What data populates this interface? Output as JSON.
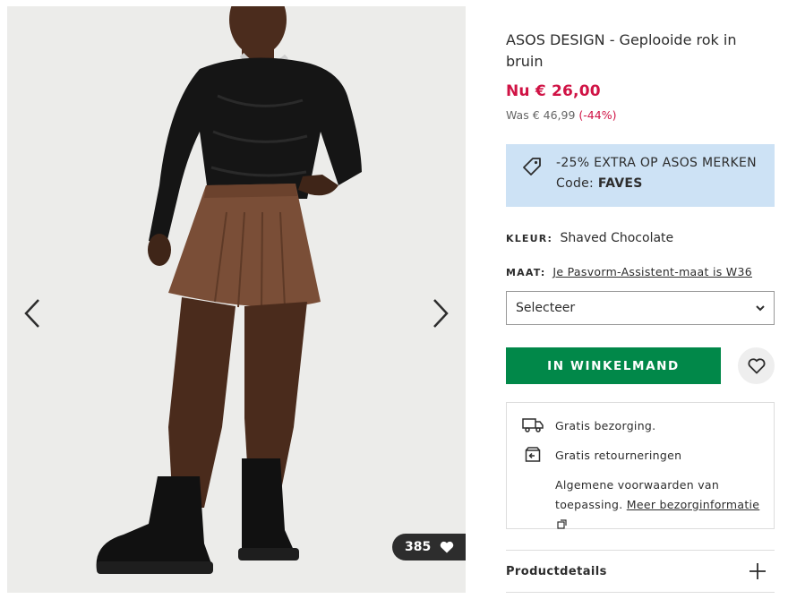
{
  "gallery": {
    "image_alt": "Model in black mesh top, brown pleated skirt and black boots",
    "prev_icon": "chevron-left-icon",
    "next_icon": "chevron-right-icon",
    "like_count": "385",
    "like_icon": "heart-icon"
  },
  "product": {
    "title": "ASOS DESIGN - Geplooide rok in bruin",
    "price_now": "Nu € 26,00",
    "price_was": "Was € 46,99",
    "discount": "(-44%)"
  },
  "promo": {
    "icon": "tag-icon",
    "line1": "-25% EXTRA OP ASOS MERKEN",
    "code_label": "Code:",
    "code": "FAVES",
    "bg_color": "#cde2f5"
  },
  "colour": {
    "label": "KLEUR:",
    "value": "Shaved Chocolate"
  },
  "size": {
    "label": "MAAT:",
    "link": "Je Pasvorm-Assistent-maat is W36",
    "select_value": "Selecteer"
  },
  "actions": {
    "add_to_bag": "IN WINKELMAND",
    "add_color": "#018849",
    "save_icon": "heart-outline-icon"
  },
  "delivery": {
    "shipping": "Gratis bezorging.",
    "returns": "Gratis retourneringen",
    "terms_text": "Algemene voorwaarden van toepassing.",
    "terms_link": "Meer bezorginformatie"
  },
  "accordion": {
    "label": "Productdetails"
  },
  "colors": {
    "sale_red": "#d01345",
    "text": "#2d2d2d"
  }
}
